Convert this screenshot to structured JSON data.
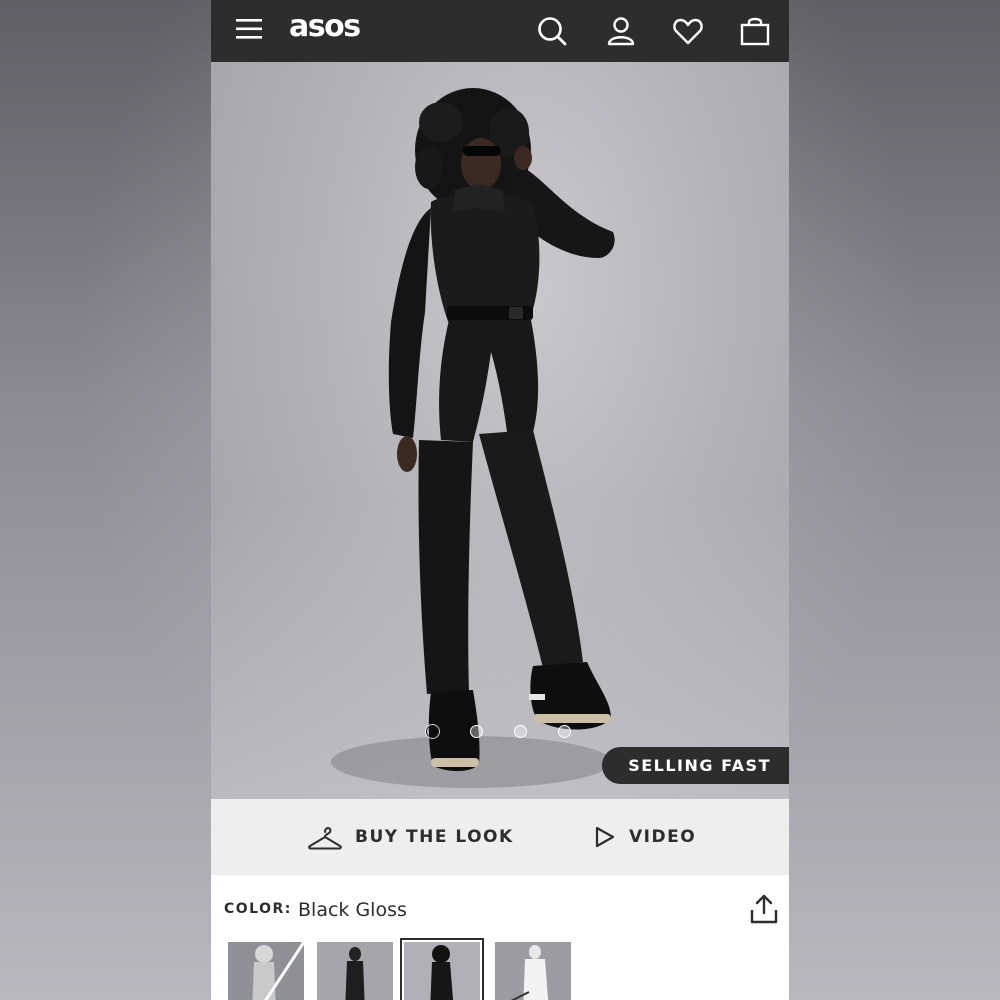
{
  "header": {
    "logo": "asos",
    "icons": [
      "menu-icon",
      "search-icon",
      "account-icon",
      "heart-icon",
      "bag-icon"
    ]
  },
  "hero": {
    "badge": "SELLING FAST",
    "carousel_count": 4,
    "carousel_active": 1
  },
  "actions": {
    "buy_the_look": "BUY THE LOOK",
    "video": "VIDEO"
  },
  "color": {
    "label": "COLOR:",
    "value": "Black Gloss",
    "swatches": [
      "Grey (unavailable)",
      "Black Matte",
      "Black Gloss",
      "White"
    ],
    "selected_index": 2
  },
  "colors": {
    "header_bg": "#2d2d2d",
    "action_bar_bg": "#eeeeee",
    "text": "#2d2d2d"
  }
}
